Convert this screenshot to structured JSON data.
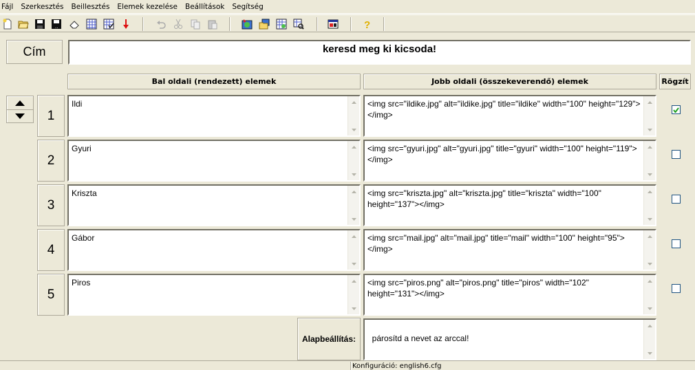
{
  "menu": [
    "Fájl",
    "Szerkesztés",
    "Beillesztés",
    "Elemek kezelése",
    "Beállítások",
    "Segítség"
  ],
  "toolbar": {
    "buttons": [
      "new-icon",
      "open-icon",
      "save-icon",
      "save-as-icon",
      "erase-icon",
      "grid-icon",
      "grid-check-icon",
      "down-arrow-icon",
      "undo-icon",
      "cut-icon",
      "copy-icon",
      "paste-icon",
      "web-export-icon",
      "web-open-icon",
      "web-settings-icon",
      "web-preview-icon",
      "window-icon",
      "help-icon"
    ]
  },
  "title_row": {
    "label": "Cím",
    "value": "keresd meg ki kicsoda!"
  },
  "headers": {
    "left": "Bal oldali (rendezett) elemek",
    "right": "Jobb oldali (összekeverendő) elemek",
    "lock": "Rögzít"
  },
  "rows": [
    {
      "num": "1",
      "left": "Ildi",
      "right": "<img src=\"ildike.jpg\" alt=\"ildike.jpg\" title=\"ildike\" width=\"100\" height=\"129\"></img>",
      "locked": true
    },
    {
      "num": "2",
      "left": "Gyuri",
      "right": "<img src=\"gyuri.jpg\" alt=\"gyuri.jpg\" title=\"gyuri\" width=\"100\" height=\"119\"></img>",
      "locked": false
    },
    {
      "num": "3",
      "left": "Kriszta",
      "right": "<img src=\"kriszta.jpg\" alt=\"kriszta.jpg\" title=\"kriszta\" width=\"100\" height=\"137\"></img>",
      "locked": false
    },
    {
      "num": "4",
      "left": "Gábor",
      "right": "<img src=\"mail.jpg\" alt=\"mail.jpg\" title=\"mail\" width=\"100\" height=\"95\"></img>",
      "locked": false
    },
    {
      "num": "5",
      "left": "Piros",
      "right": "<img src=\"piros.png\" alt=\"piros.png\" title=\"piros\" width=\"102\" height=\"131\"></img>",
      "locked": false
    }
  ],
  "default_row": {
    "label": "Alapbeállítás:",
    "value": "párosítd a nevet az arccal!"
  },
  "status": {
    "config": "Konfiguráció: english6.cfg"
  }
}
